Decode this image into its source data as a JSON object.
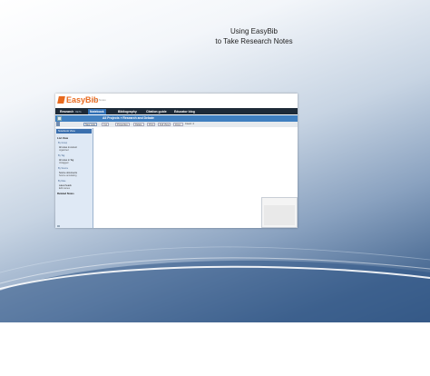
{
  "slide": {
    "title_line1": "Using EasyBib",
    "title_line2": "to Take Research Notes"
  },
  "app": {
    "logo": "EasyBib",
    "logo_sub": "Your Notes",
    "nav_tabs": [
      {
        "label": "Research",
        "badge": "BETA"
      },
      {
        "label": "Notebook"
      },
      {
        "label": "Bibliography"
      },
      {
        "label": "Citation guide"
      },
      {
        "label": "Educator blog"
      }
    ],
    "project_title": "All Projects » Research and Debate",
    "toolbar": {
      "buttons": [
        "New note",
        "Cut",
        "Properties",
        "Delete",
        "Print",
        "Full View",
        "Zoom"
      ],
      "count": "Count: 4"
    },
    "sidebar": {
      "header": "Notebook View",
      "section1": "List View",
      "group1": "By Group",
      "item1": "All notes in current",
      "item1b": "organized",
      "group2": "By Tag",
      "item2": "All notes in Tag",
      "item2b": "Untagged",
      "group3": "By Source",
      "item3": "Source documents",
      "item3b": "Source annotating",
      "group4": "By Date",
      "item4": "Latest heads",
      "item4b": "Edit names",
      "section2": "Related Notes"
    }
  },
  "colors": {
    "logo_orange": "#e86a1f",
    "nav_dark": "#1d2a38",
    "nav_active": "#2f6fb4",
    "project_bar": "#3f7fc0",
    "sidebar_bg": "#dfe9f5"
  }
}
